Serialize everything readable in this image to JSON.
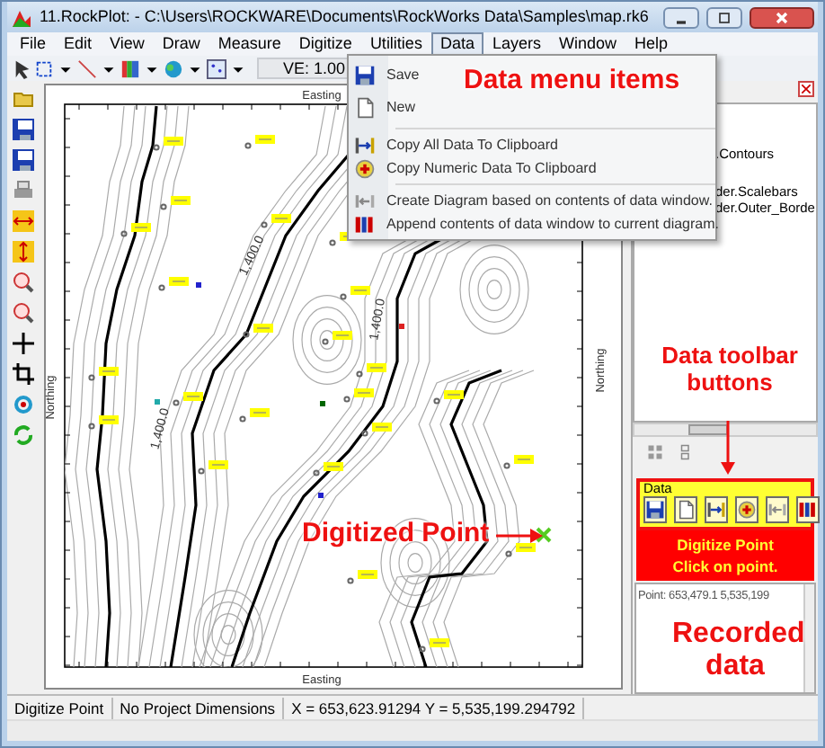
{
  "window": {
    "title": "11.RockPlot:  - C:\\Users\\ROCKWARE\\Documents\\RockWorks Data\\Samples\\map.rk6"
  },
  "menu_bar": [
    {
      "label": "File",
      "selected": false
    },
    {
      "label": "Edit",
      "selected": false
    },
    {
      "label": "View",
      "selected": false
    },
    {
      "label": "Draw",
      "selected": false
    },
    {
      "label": "Measure",
      "selected": false
    },
    {
      "label": "Digitize",
      "selected": false
    },
    {
      "label": "Utilities",
      "selected": false
    },
    {
      "label": "Data",
      "selected": true
    },
    {
      "label": "Layers",
      "selected": false
    },
    {
      "label": "Window",
      "selected": false
    },
    {
      "label": "Help",
      "selected": false
    }
  ],
  "toolbar": {
    "ve_label": "VE: 1.00"
  },
  "data_menu": {
    "groups": [
      [
        {
          "label": "Save"
        },
        {
          "label": "New"
        }
      ],
      [
        {
          "label": "Copy All Data To Clipboard"
        },
        {
          "label": "Copy Numeric Data To Clipboard"
        }
      ],
      [
        {
          "label": "Create Diagram based on contents of data window."
        },
        {
          "label": "Append contents of data window to current diagram."
        }
      ]
    ]
  },
  "map": {
    "top_axis_title": "Easting",
    "bottom_axis_title": "Easting",
    "left_axis_title": "Northing",
    "right_axis_title": "Northing",
    "contour_labels": [
      "1,400.0",
      "1,400.0",
      "1,400.0"
    ]
  },
  "side_panel": {
    "tree_items": [
      ".Contours",
      "der.Scalebars",
      "der.Outer_Borde"
    ]
  },
  "data_toolbar": {
    "title": "Data"
  },
  "digitize_prompt": {
    "title": "Digitize Point",
    "hint": "Click on point."
  },
  "recorded_text": "Point: 653,479.1 5,535,199",
  "status_bar": [
    "Digitize Point",
    "No Project Dimensions",
    "X = 653,623.91294  Y = 5,535,199.294792"
  ],
  "annotations": [
    {
      "kind": "menu",
      "text": "Data menu items"
    },
    {
      "kind": "toolbar",
      "text": "Data toolbar buttons"
    },
    {
      "kind": "point",
      "text": "Digitized Point"
    },
    {
      "kind": "recorded",
      "text": "Recorded data"
    }
  ]
}
